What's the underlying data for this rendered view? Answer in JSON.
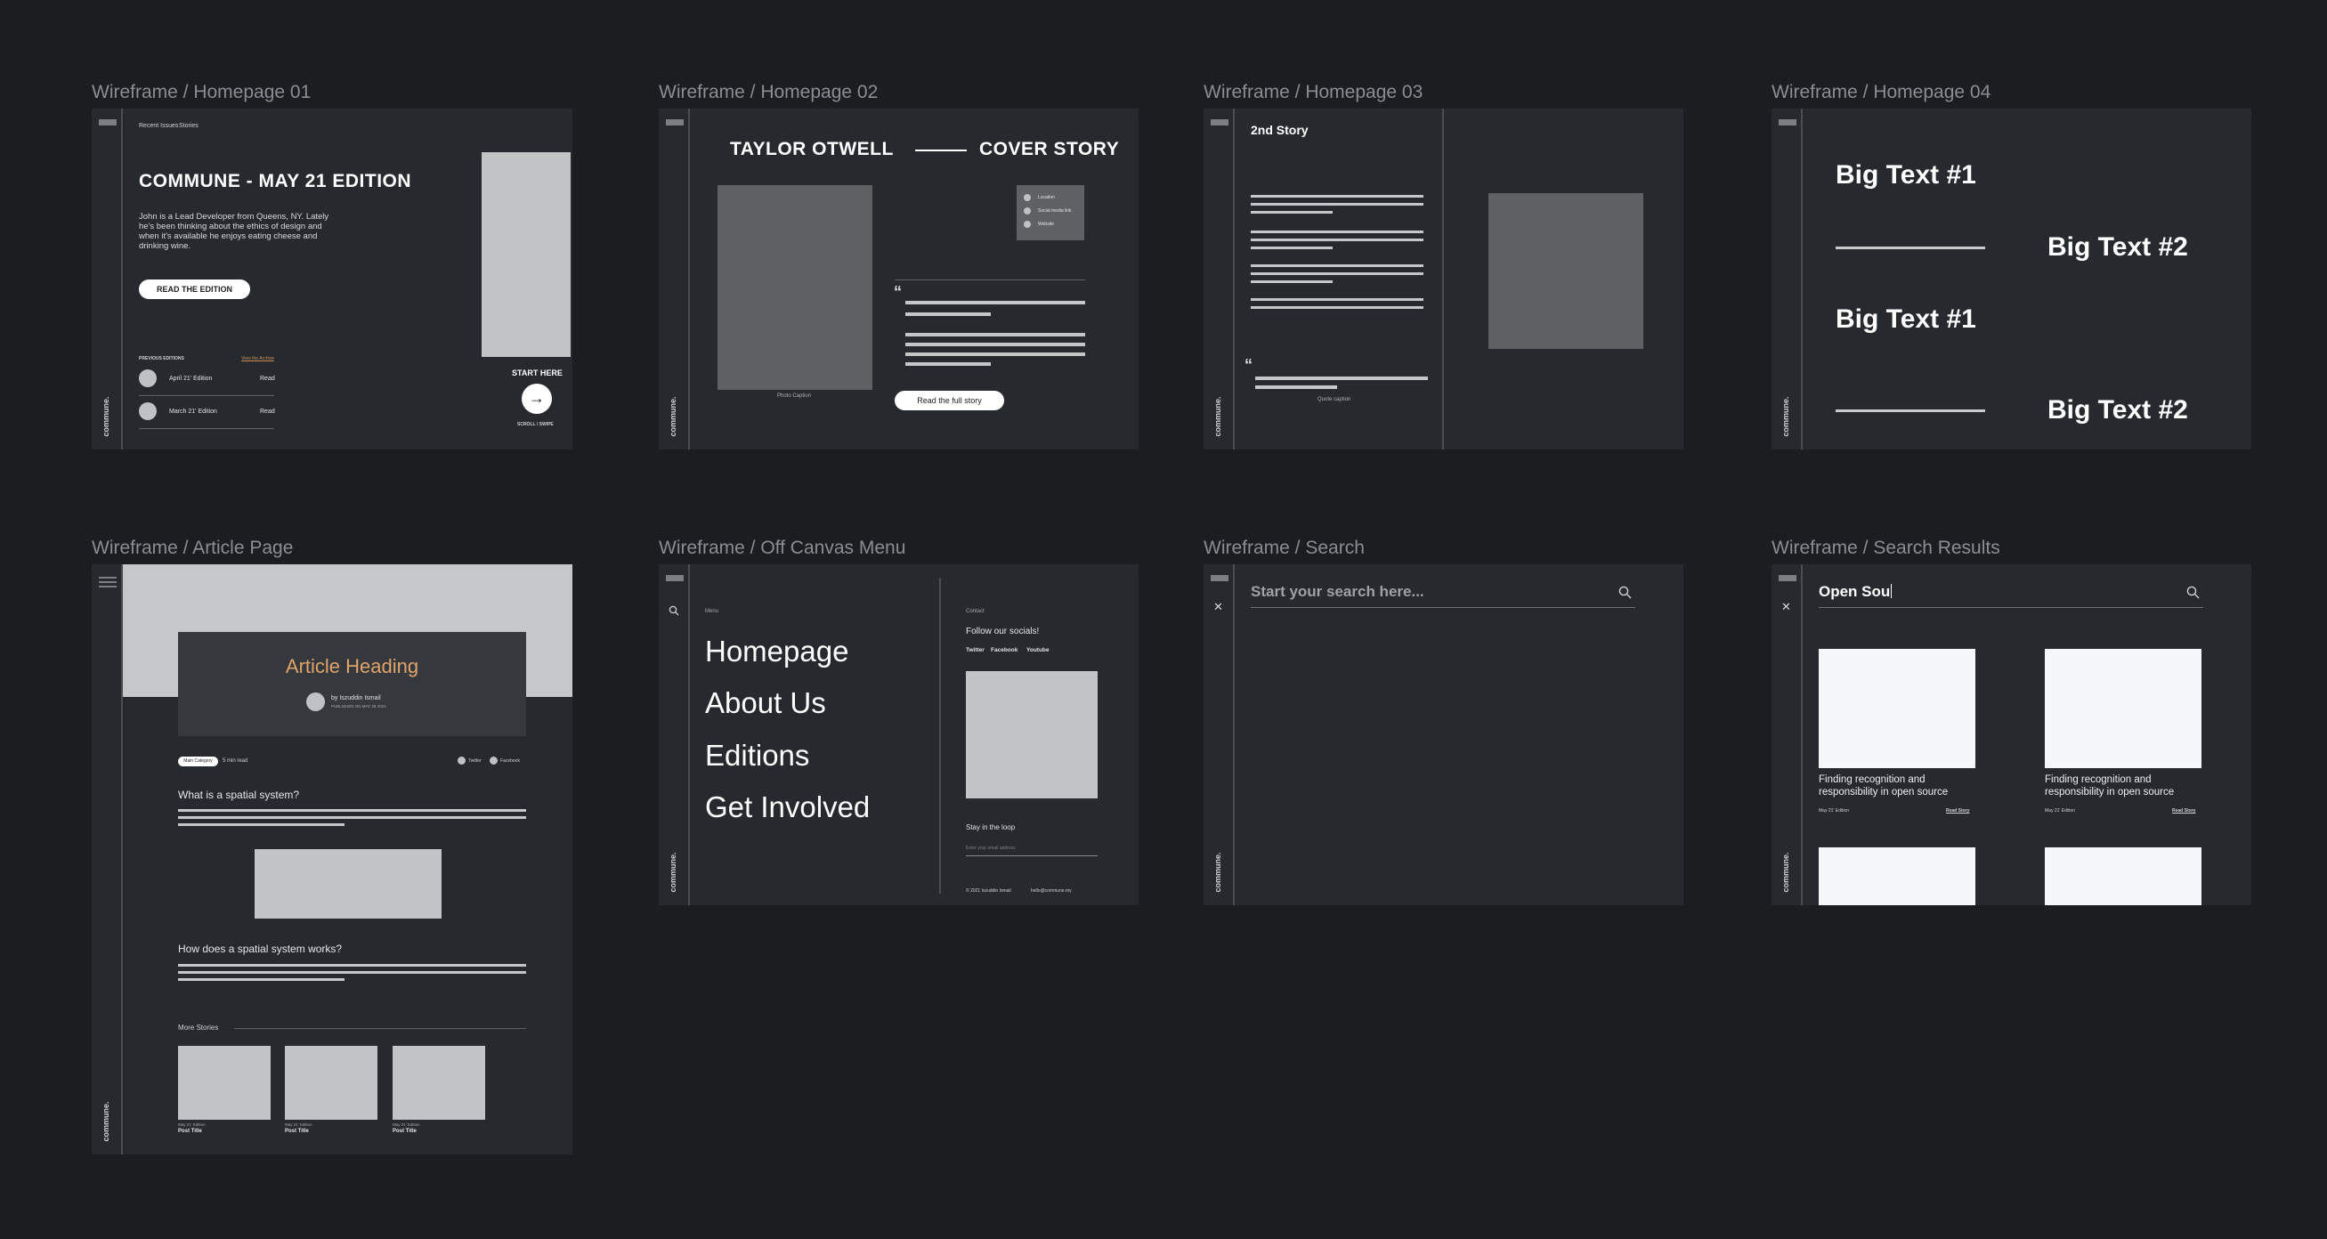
{
  "frames": {
    "f1": {
      "title": "Wireframe / Homepage 01",
      "logo": "commune.",
      "nav": [
        "Recent Issues",
        "Stories"
      ],
      "heading": "COMMUNE - MAY 21 EDITION",
      "intro": "John is a Lead Developer from Queens, NY. Lately he's been thinking about the ethics of design and when it's available he enjoys eating cheese and drinking wine.",
      "cta": "READ THE EDITION",
      "prev_label": "PREVIOUS EDITIONS",
      "view_all": "View the Archive",
      "editions": [
        {
          "name": "April 21' Edition",
          "action": "Read"
        },
        {
          "name": "March 21' Edition",
          "action": "Read"
        }
      ],
      "start_here": "START HERE",
      "scroll_hint": "SCROLL / SWIPE"
    },
    "f2": {
      "title": "Wireframe / Homepage 02",
      "logo": "commune.",
      "name": "TAYLOR OTWELL",
      "label": "COVER STORY",
      "caption": "Photo Caption",
      "meta": [
        "Location",
        "Social media link",
        "Website"
      ],
      "quote_mark": "“",
      "cta": "Read the full story"
    },
    "f3": {
      "title": "Wireframe / Homepage 03",
      "logo": "commune.",
      "heading": "2nd Story",
      "quote_mark": "“",
      "caption": "Quote caption"
    },
    "f4": {
      "title": "Wireframe / Homepage 04",
      "logo": "commune.",
      "big1": "Big Text #1",
      "big2": "Big Text #2"
    },
    "f5": {
      "title": "Wireframe / Article Page",
      "logo": "commune.",
      "heading": "Article Heading",
      "author": "by Iszuddin Ismail",
      "date": "PUBLISHED ON MAY 28 2021",
      "tag": "Main Category",
      "read": "5 min read",
      "socials": [
        "Twitter",
        "Facebook"
      ],
      "q1": "What is a spatial system?",
      "q2": "How does a spatial system works?",
      "more": "More Stories",
      "posts": [
        {
          "date": "May 21' Edition",
          "title": "Post Title"
        },
        {
          "date": "May 21' Edition",
          "title": "Post Title"
        },
        {
          "date": "May 21' Edition",
          "title": "Post Title"
        }
      ]
    },
    "f6": {
      "title": "Wireframe / Off Canvas Menu",
      "logo": "commune.",
      "menu_label": "Menu",
      "menu": [
        "Homepage",
        "About Us",
        "Editions",
        "Get Involved"
      ],
      "contact_label": "Contact",
      "follow": "Follow our socials!",
      "socials": [
        "Twitter",
        "Facebook",
        "Youtube"
      ],
      "loop": "Stay in the loop",
      "email_placeholder": "Enter your email address",
      "copyright": "© 2021 Iszuddin Ismail",
      "email": "hello@commune.my"
    },
    "f7": {
      "title": "Wireframe / Search",
      "logo": "commune.",
      "placeholder": "Start your search here..."
    },
    "f8": {
      "title": "Wireframe / Search Results",
      "logo": "commune.",
      "query": "Open Sou",
      "results": [
        {
          "title": "Finding recognition and responsibility in open source",
          "date": "May 21' Edition",
          "link": "Read Story"
        },
        {
          "title": "Finding recognition and responsibility in open source",
          "date": "May 21' Edition",
          "link": "Read Story"
        }
      ]
    }
  }
}
